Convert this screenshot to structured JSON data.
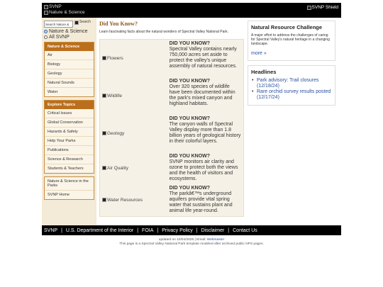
{
  "header": {
    "logo_alt_1": "SVNP",
    "logo_alt_2": "Nature & Science",
    "shield_alt": "SVNP Shield"
  },
  "sidebar": {
    "search_value": "Search Nature &",
    "search_button": "Search",
    "radio_1": "Nature & Science",
    "radio_2": "All SVNP",
    "nav_heading": "Nature & Science",
    "nav_items": [
      "Air",
      "Biology",
      "Geology",
      "Natural Sounds",
      "Water"
    ],
    "explore_heading": "Explore Topics",
    "explore_items": [
      "Critical Issues",
      "Global Conservation",
      "Hazards & Safety",
      "Help Your Parks",
      "Publications",
      "Science & Research",
      "Students & Teachers"
    ],
    "bottom_items": [
      "Nature & Science in the Parks",
      "SVNP Home"
    ]
  },
  "main": {
    "title": "Did You Know?",
    "intro": "Learn fascinating facts about the natural wonders of Spectral Valley National Park.",
    "facts": [
      {
        "img_alt": "Flowers",
        "title": "DID YOU KNOW?",
        "text": "Spectral Valley contains nearly 750,000 acres set aside to protect the valley's unique assembly of natural resources."
      },
      {
        "img_alt": "Wildlife",
        "title": "DID YOU KNOW?",
        "text": "Over 320 species of wildlife have been documented within the park's mixed canyon and highland habitats."
      },
      {
        "img_alt": "Geology",
        "title": "DID YOU KNOW?",
        "text": "The canyon walls of Spectral Valley display more than 1.8 billion years of geological history in their colorful layers."
      },
      {
        "img_alt": "Air Quality",
        "title": "DID YOU KNOW?",
        "text": "SVNP monitors air clarity and ozone to protect both the views and the health of visitors and ecosystems."
      },
      {
        "img_alt": "Water Resources",
        "title": "DID YOU KNOW?",
        "text": "The parkâ€™s underground aquifers provide vital spring water that sustains plant and animal life year-round."
      }
    ]
  },
  "right": {
    "challenge_title": "Natural Resource Challenge",
    "challenge_text": "A major effort to address the challenges of caring for Spectral Valley's natural heritage in a changing landscape.",
    "more_link": "more »",
    "headlines_title": "Headlines",
    "headlines": [
      "Park advisory: Trail closures (12/18/24)",
      "Rare orchid survey results posted (12/17/24)"
    ]
  },
  "footer": {
    "links": [
      "SVNP",
      "U.S. Department of the Interior",
      "FOIA",
      "Privacy Policy",
      "Disclaimer",
      "Contact Us"
    ],
    "updated": "updated on 10/04/2025",
    "email_label": "Email:",
    "webmaster": "Webmaster",
    "note": "This page is a Spectral Valley National Park template modeled after archived public NPS pages."
  }
}
